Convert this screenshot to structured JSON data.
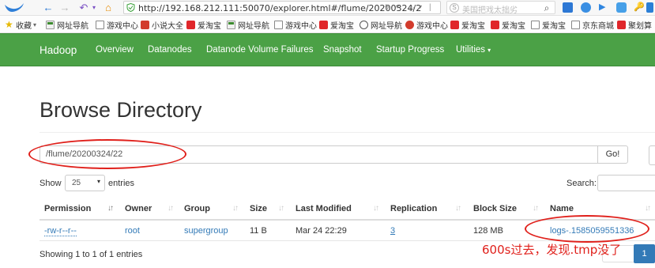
{
  "browser": {
    "url": "http://192.168.212.111:50070/explorer.html#/flume/20200324/2",
    "search_placeholder": "美国把戏太拙劣"
  },
  "bookmarks": [
    {
      "label": "收藏",
      "icon": "star-icon"
    },
    {
      "label": "网址导航",
      "icon": "hao123-icon"
    },
    {
      "label": "游戏中心",
      "icon": "page-icon"
    },
    {
      "label": "小说大全",
      "icon": "novel-icon"
    },
    {
      "label": "爱淘宝",
      "icon": "taobao-icon"
    },
    {
      "label": "网址导航",
      "icon": "hao123-icon"
    },
    {
      "label": "游戏中心",
      "icon": "page-icon"
    },
    {
      "label": "爱淘宝",
      "icon": "taobao-icon"
    },
    {
      "label": "网址导航",
      "icon": "globe-icon"
    },
    {
      "label": "游戏中心",
      "icon": "game-icon"
    },
    {
      "label": "爱淘宝",
      "icon": "taobao-icon"
    },
    {
      "label": "爱淘宝",
      "icon": "taobao-icon"
    },
    {
      "label": "爱淘宝",
      "icon": "page-icon"
    },
    {
      "label": "京东商城",
      "icon": "page-icon"
    },
    {
      "label": "聚划算",
      "icon": "taobao-icon"
    }
  ],
  "navbar": {
    "brand": "Hadoop",
    "items": [
      "Overview",
      "Datanodes",
      "Datanode Volume Failures",
      "Snapshot",
      "Startup Progress",
      "Utilities"
    ]
  },
  "page": {
    "title": "Browse Directory",
    "path": "/flume/20200324/22",
    "go_label": "Go!",
    "show_label": "Show",
    "page_size": "25",
    "entries_label": "entries",
    "search_label": "Search:",
    "info": "Showing 1 to 1 of 1 entries",
    "current_page": "1"
  },
  "table": {
    "columns": [
      "Permission",
      "Owner",
      "Group",
      "Size",
      "Last Modified",
      "Replication",
      "Block Size",
      "Name"
    ],
    "rows": [
      {
        "permission": "-rw-r--r--",
        "owner": "root",
        "group": "supergroup",
        "size": "11 B",
        "modified": "Mar 24 22:29",
        "replication": "3",
        "block_size": "128 MB",
        "name": "logs-.1585059551336"
      }
    ]
  },
  "annotation": {
    "text": "600s过去，发现.tmp没了",
    "color": "#e0201b"
  },
  "colors": {
    "navbar": "#4ba146",
    "link": "#337ab7"
  }
}
